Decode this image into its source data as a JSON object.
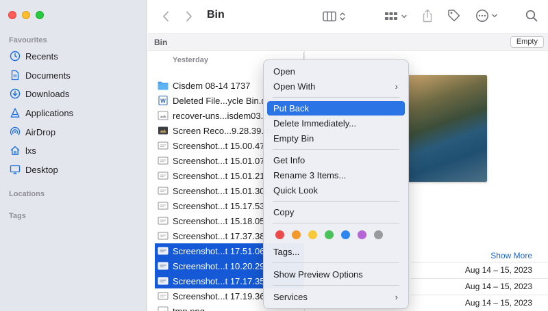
{
  "window": {
    "title": "Bin"
  },
  "sidebar": {
    "favourites_label": "Favourites",
    "locations_label": "Locations",
    "tags_label": "Tags",
    "items": [
      {
        "label": "Recents",
        "icon": "clock-icon"
      },
      {
        "label": "Documents",
        "icon": "document-icon"
      },
      {
        "label": "Downloads",
        "icon": "download-icon"
      },
      {
        "label": "Applications",
        "icon": "applications-icon"
      },
      {
        "label": "AirDrop",
        "icon": "airdrop-icon"
      },
      {
        "label": "lxs",
        "icon": "home-icon"
      },
      {
        "label": "Desktop",
        "icon": "desktop-icon"
      }
    ]
  },
  "pathbar": {
    "crumb": "Bin",
    "empty_label": "Empty"
  },
  "file_list": {
    "group_header": "Yesterday",
    "rows": [
      {
        "name": "Cisdem 08-14 1737",
        "kind": "folder",
        "selected": false
      },
      {
        "name": "Deleted File...ycle Bin.docx",
        "kind": "word",
        "selected": false
      },
      {
        "name": "recover-uns...isdem03.png",
        "kind": "image",
        "selected": false
      },
      {
        "name": "Screen Reco...9.28.39.mov",
        "kind": "video",
        "selected": false
      },
      {
        "name": "Screenshot...t 15.00.47",
        "kind": "screenshot",
        "selected": false
      },
      {
        "name": "Screenshot...t 15.01.07",
        "kind": "screenshot",
        "selected": false
      },
      {
        "name": "Screenshot...t 15.01.21",
        "kind": "screenshot",
        "selected": false
      },
      {
        "name": "Screenshot...t 15.01.30",
        "kind": "screenshot",
        "selected": false
      },
      {
        "name": "Screenshot...t 15.17.53",
        "kind": "screenshot",
        "selected": false
      },
      {
        "name": "Screenshot...t 15.18.05",
        "kind": "screenshot",
        "selected": false
      },
      {
        "name": "Screenshot...t 17.37.38",
        "kind": "screenshot",
        "selected": false
      },
      {
        "name": "Screenshot...t 17.51.06",
        "kind": "screenshot",
        "selected": true
      },
      {
        "name": "Screenshot...t 10.20.29",
        "kind": "screenshot",
        "selected": true
      },
      {
        "name": "Screenshot...t 17.17.35",
        "kind": "screenshot",
        "selected": true
      },
      {
        "name": "Screenshot...t 17.19.36",
        "kind": "screenshot",
        "selected": false
      },
      {
        "name": "tmp.png",
        "kind": "image",
        "selected": false
      }
    ]
  },
  "preview": {
    "show_more_label": "Show More",
    "dates": [
      "Aug 14 – 15, 2023",
      "Aug 14 – 15, 2023",
      "Aug 14 – 15, 2023"
    ]
  },
  "context_menu": {
    "items": [
      {
        "label": "Open"
      },
      {
        "label": "Open With",
        "submenu": true
      },
      {
        "label": "Put Back",
        "active": true
      },
      {
        "label": "Delete Immediately..."
      },
      {
        "label": "Empty Bin"
      },
      {
        "label": "Get Info"
      },
      {
        "label": "Rename 3 Items..."
      },
      {
        "label": "Quick Look"
      },
      {
        "label": "Copy"
      },
      {
        "label": "Tags..."
      },
      {
        "label": "Show Preview Options"
      },
      {
        "label": "Services",
        "submenu": true
      }
    ],
    "tag_colors": [
      "#ec4b4b",
      "#f39a2e",
      "#f7c93a",
      "#4ac15a",
      "#2f86f0",
      "#b466d6",
      "#9a9a9e"
    ]
  },
  "colors": {
    "selection": "#1559d6",
    "menu_highlight": "#2b74e6",
    "link": "#1a66d9"
  }
}
